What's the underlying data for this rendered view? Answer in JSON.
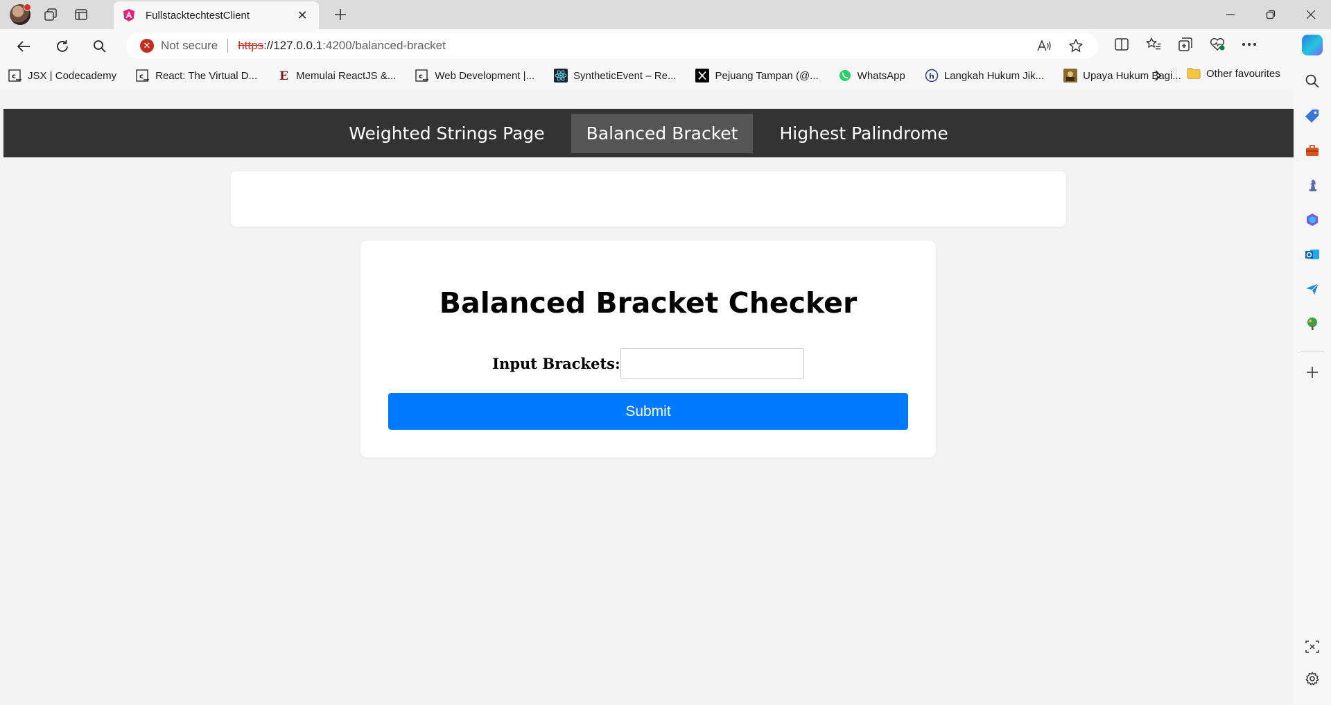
{
  "browser": {
    "tab": {
      "title": "FullstacktechtestClient"
    },
    "address": {
      "security_text": "Not secure",
      "url_proto": "https",
      "url_host": "://127.0.0.1",
      "url_path": ":4200/balanced-bracket"
    },
    "bookmarks": [
      {
        "label": "JSX | Codecademy",
        "icon": "codecademy-icon"
      },
      {
        "label": "React: The Virtual D...",
        "icon": "codecademy-icon"
      },
      {
        "label": "Memulai ReactJS &...",
        "icon": "e-letter-icon"
      },
      {
        "label": "Web Development |...",
        "icon": "codecademy-icon"
      },
      {
        "label": "SyntheticEvent – Re...",
        "icon": "react-icon"
      },
      {
        "label": "Pejuang Tampan (@...",
        "icon": "x-icon"
      },
      {
        "label": "WhatsApp",
        "icon": "whatsapp-icon"
      },
      {
        "label": "Langkah Hukum Jik...",
        "icon": "h-circle-icon"
      },
      {
        "label": "Upaya Hukum Bagi...",
        "icon": "image-thumb-icon"
      }
    ],
    "other_favourites": "Other favourites"
  },
  "app": {
    "nav": {
      "items": [
        {
          "label": "Weighted Strings Page"
        },
        {
          "label": "Balanced Bracket"
        },
        {
          "label": "Highest Palindrome"
        }
      ],
      "active_index": 1
    },
    "card": {
      "title": "Balanced Bracket Checker",
      "input_label": "Input Brackets:",
      "input_value": "",
      "submit_label": "Submit"
    }
  },
  "colors": {
    "nav_bg": "#333333",
    "nav_active": "#555555",
    "submit_bg": "#007bff",
    "page_bg": "#f3f3f3"
  }
}
